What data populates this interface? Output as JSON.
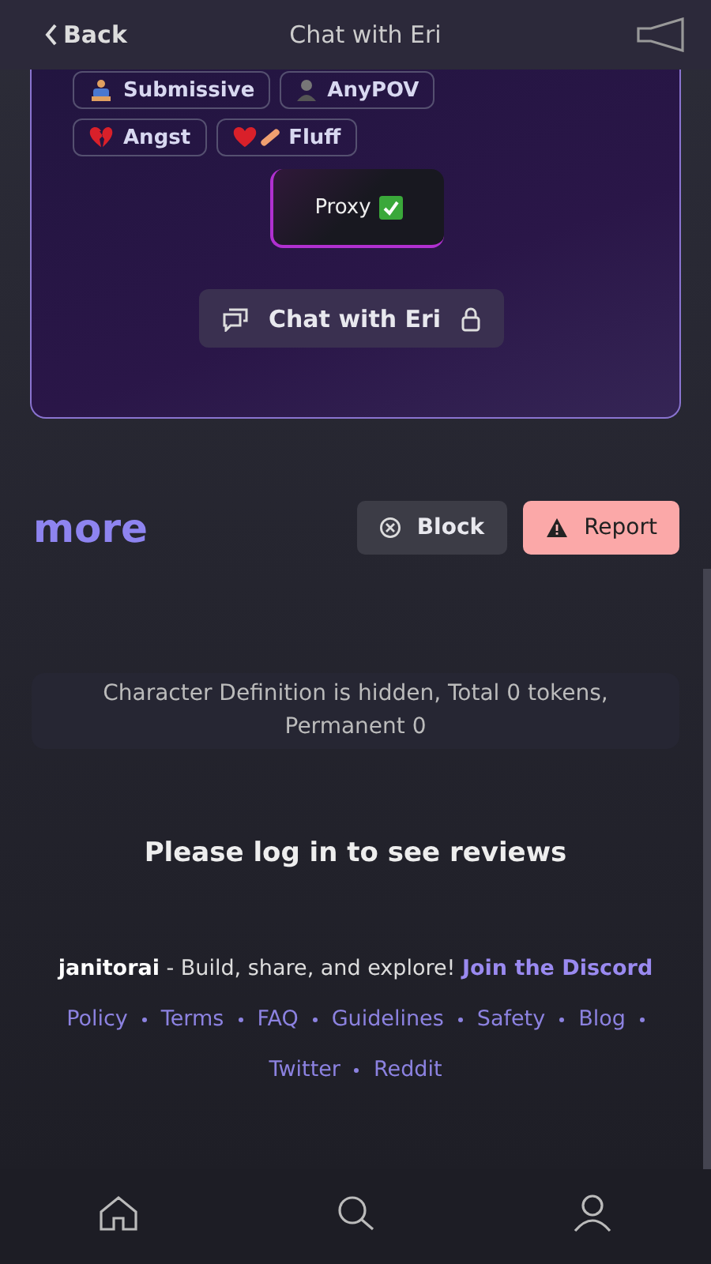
{
  "header": {
    "back": "Back",
    "title": "Chat with Eri"
  },
  "tags": [
    {
      "kind": "bow",
      "label": "Submissive"
    },
    {
      "kind": "person",
      "label": "AnyPOV"
    },
    {
      "kind": "broken-heart",
      "label": "Angst"
    },
    {
      "kind": "mending-heart",
      "label": "Fluff"
    }
  ],
  "proxy": {
    "label": "Proxy",
    "checked": true
  },
  "chat_button": {
    "label": "Chat with Eri",
    "locked": true
  },
  "more": "more",
  "actions": [
    {
      "kind": "block",
      "label": "Block"
    },
    {
      "kind": "report",
      "label": "Report"
    }
  ],
  "definition": "Character Definition is hidden, Total 0 tokens, Permanent 0",
  "reviews": "Please log in to see reviews",
  "footer": {
    "brand": "janitorai",
    "tagline": " - Build, share, and explore! ",
    "link": "Join the Discord"
  },
  "links": [
    "Policy",
    "Terms",
    "FAQ",
    "Guidelines",
    "Safety",
    "Blog",
    "Twitter",
    "Reddit"
  ],
  "nav": [
    {
      "kind": "home"
    },
    {
      "kind": "search"
    },
    {
      "kind": "profile"
    }
  ]
}
